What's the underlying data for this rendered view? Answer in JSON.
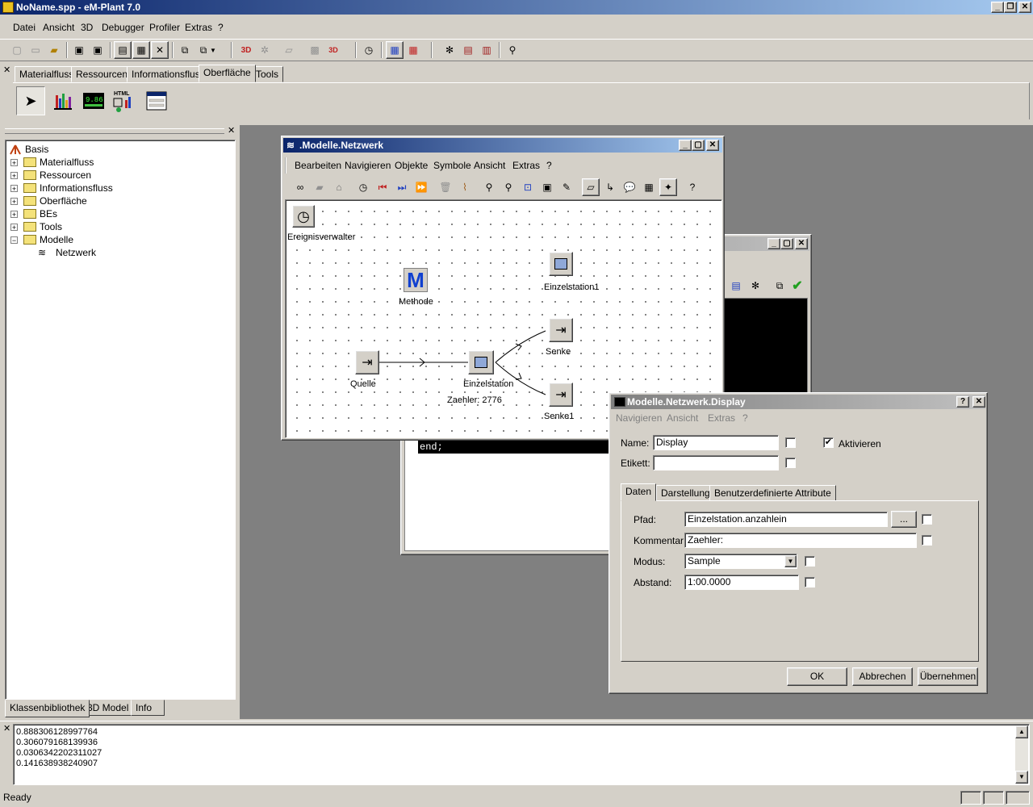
{
  "app": {
    "title": "NoName.spp - eM-Plant 7.0",
    "menu": [
      "Datei",
      "Ansicht",
      "3D",
      "Debugger",
      "Profiler",
      "Extras",
      "?"
    ]
  },
  "palette": {
    "tabs": [
      "Materialfluss",
      "Ressourcen",
      "Informationsfluss",
      "Oberfläche",
      "Tools"
    ],
    "selected": "Oberfläche"
  },
  "library": {
    "items": [
      {
        "label": "Basis"
      },
      {
        "label": "Materialfluss"
      },
      {
        "label": "Ressourcen"
      },
      {
        "label": "Informationsfluss"
      },
      {
        "label": "Oberfläche"
      },
      {
        "label": "BEs"
      },
      {
        "label": "Tools"
      },
      {
        "label": "Modelle"
      },
      {
        "label": "Netzwerk"
      }
    ],
    "bottom_tabs": [
      "Klassenbibliothek",
      "3D Model",
      "Info"
    ]
  },
  "network": {
    "title": ".Modelle.Netzwerk",
    "menu": [
      "Bearbeiten",
      "Navigieren",
      "Objekte",
      "Symbole",
      "Ansicht",
      "Extras",
      "?"
    ],
    "objects": {
      "eventmgr": "Ereignisverwalter",
      "method": "Methode",
      "station1": "Einzelstation1",
      "source": "Quelle",
      "station": "Einzelstation",
      "sink": "Senke",
      "sink1": "Senke1",
      "counter": "Zaehler: 2776"
    }
  },
  "method_window": {
    "code_line": "end;"
  },
  "dialog": {
    "title": "Modelle.Netzwerk.Display",
    "menu": [
      "Navigieren",
      "Ansicht",
      "Extras",
      "?"
    ],
    "name_label": "Name:",
    "name_value": "Display",
    "label_label": "Etikett:",
    "label_value": "",
    "activate_label": "Aktivieren",
    "activate_checked": true,
    "tabs": [
      "Daten",
      "Darstellung",
      "Benutzerdefinierte Attribute"
    ],
    "path_label": "Pfad:",
    "path_value": "Einzelstation.anzahlein",
    "browse_label": "...",
    "comment_label": "Kommentar:",
    "comment_value": "Zaehler:",
    "mode_label": "Modus:",
    "mode_value": "Sample",
    "interval_label": "Abstand:",
    "interval_value": "1:00.0000",
    "ok": "OK",
    "cancel": "Abbrechen",
    "apply": "Übernehmen"
  },
  "console": {
    "lines": [
      "0.888306128997764",
      "0.306079168139936",
      "0.0306342202311027",
      "0.141638938240907"
    ]
  },
  "status": {
    "text": "Ready"
  }
}
